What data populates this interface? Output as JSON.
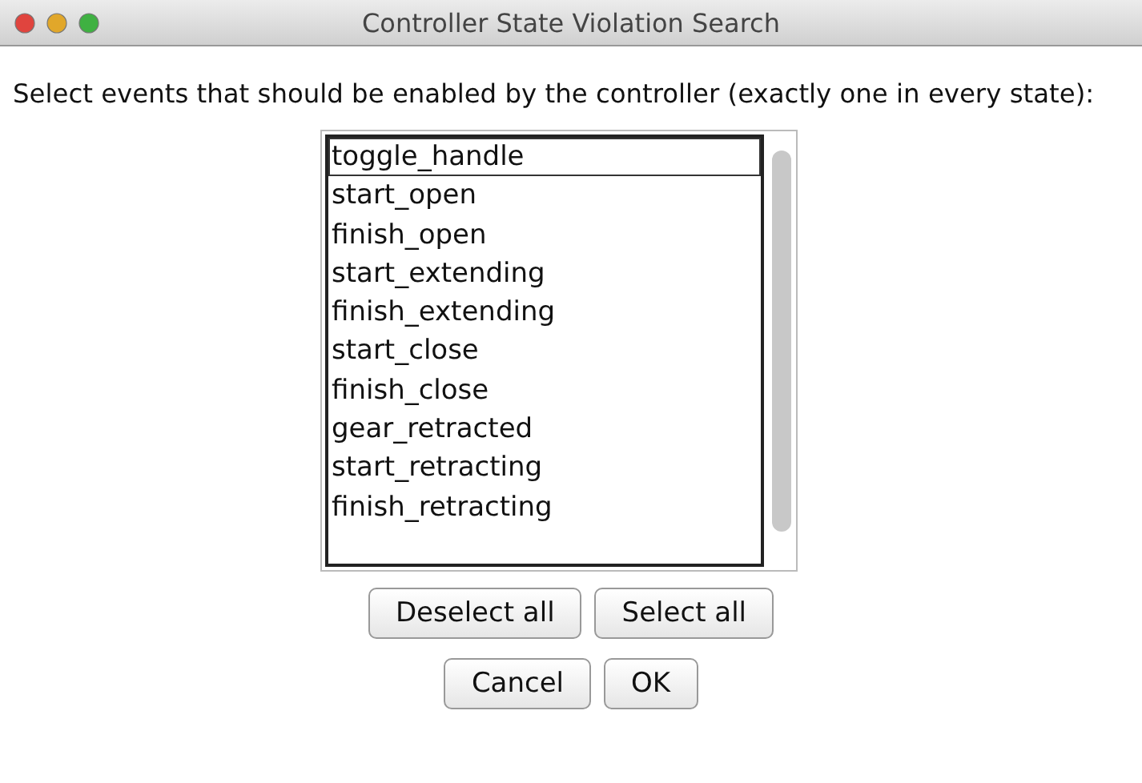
{
  "window": {
    "title": "Controller State Violation Search"
  },
  "instruction": "Select events that should be enabled by the controller (exactly one in every state):",
  "events": [
    {
      "label": "toggle_handle",
      "selected": false,
      "focused": true
    },
    {
      "label": "start_open",
      "selected": false,
      "focused": false
    },
    {
      "label": "finish_open",
      "selected": false,
      "focused": false
    },
    {
      "label": "start_extending",
      "selected": false,
      "focused": false
    },
    {
      "label": "finish_extending",
      "selected": false,
      "focused": false
    },
    {
      "label": "start_close",
      "selected": false,
      "focused": false
    },
    {
      "label": "finish_close",
      "selected": false,
      "focused": false
    },
    {
      "label": "gear_retracted",
      "selected": false,
      "focused": false
    },
    {
      "label": "start_retracting",
      "selected": false,
      "focused": false
    },
    {
      "label": "finish_retracting",
      "selected": false,
      "focused": false
    }
  ],
  "selection_buttons": [
    "Deselect all",
    "Select all"
  ],
  "dialog_buttons": [
    "Cancel",
    "OK"
  ]
}
